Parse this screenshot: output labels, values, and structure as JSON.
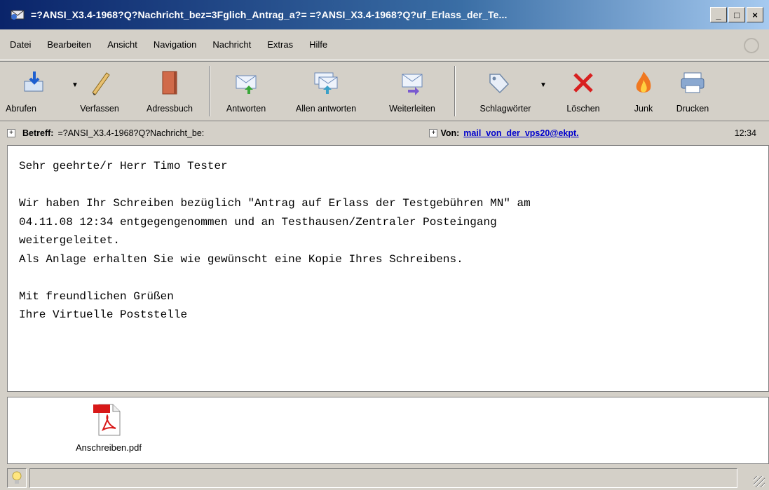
{
  "window": {
    "title": "=?ANSI_X3.4-1968?Q?Nachricht_bez=3Fglich_Antrag_a?= =?ANSI_X3.4-1968?Q?uf_Erlass_der_Te...",
    "minimize_label": "_",
    "maximize_label": "□",
    "close_label": "×"
  },
  "menubar": {
    "items": [
      {
        "label": "Datei"
      },
      {
        "label": "Bearbeiten"
      },
      {
        "label": "Ansicht"
      },
      {
        "label": "Navigation"
      },
      {
        "label": "Nachricht"
      },
      {
        "label": "Extras"
      },
      {
        "label": "Hilfe"
      }
    ]
  },
  "toolbar": {
    "buttons": [
      {
        "label": "Abrufen",
        "icon": "get-mail-icon"
      },
      {
        "label": "Verfassen",
        "icon": "pencil-icon"
      },
      {
        "label": "Adressbuch",
        "icon": "address-book-icon"
      },
      {
        "label": "Antworten",
        "icon": "reply-icon"
      },
      {
        "label": "Allen antworten",
        "icon": "reply-all-icon"
      },
      {
        "label": "Weiterleiten",
        "icon": "forward-icon"
      },
      {
        "label": "Schlagwörter",
        "icon": "tag-icon"
      },
      {
        "label": "Löschen",
        "icon": "delete-icon"
      },
      {
        "label": "Junk",
        "icon": "junk-flame-icon"
      },
      {
        "label": "Drucken",
        "icon": "print-icon"
      }
    ]
  },
  "header": {
    "subject_label": "Betreff:",
    "subject_value": "=?ANSI_X3.4-1968?Q?Nachricht_be:",
    "from_label": "Von:",
    "from_value": "mail_von_der_vps20@ekpt.",
    "time": "12:34"
  },
  "message": {
    "body": "Sehr geehrte/r Herr Timo Tester\n\nWir haben Ihr Schreiben bezüglich \"Antrag auf Erlass der Testgebühren MN\" am\n04.11.08 12:34 entgegengenommen und an Testhausen/Zentraler Posteingang\nweitergeleitet.\nAls Anlage erhalten Sie wie gewünscht eine Kopie Ihres Schreibens.\n\nMit freundlichen Grüßen\nIhre Virtuelle Poststelle"
  },
  "attachments": [
    {
      "filename": "Anschreiben.pdf",
      "icon": "pdf-file-icon"
    }
  ]
}
